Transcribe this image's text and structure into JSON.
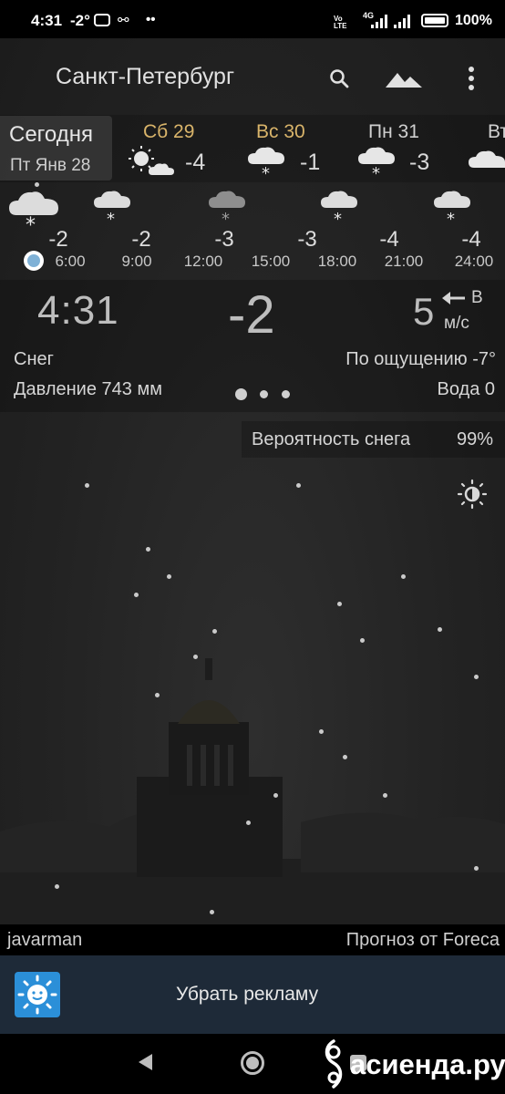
{
  "status_bar": {
    "time": "4:31",
    "temp": "-2°",
    "network": "4G",
    "volte": "Vo LTE",
    "battery": "100%"
  },
  "header": {
    "city": "Санкт-Петербург",
    "icons": [
      "search-icon",
      "landscape-icon",
      "more-vert-icon"
    ]
  },
  "days": {
    "today": {
      "label": "Сегодня",
      "date": "Пт Янв 28"
    },
    "items": [
      {
        "name": "Сб 29",
        "temp": "-4",
        "color": "#d9b46a",
        "icon": "partly-cloudy-icon"
      },
      {
        "name": "Вс 30",
        "temp": "-1",
        "color": "#d9b46a",
        "icon": "snow-cloud-icon"
      },
      {
        "name": "Пн 31",
        "temp": "-3",
        "color": "#d0d0d0",
        "icon": "snow-cloud-icon"
      },
      {
        "name": "Вт",
        "color": "#d0d0d0",
        "icon": "cloud-icon"
      }
    ]
  },
  "hourly": [
    {
      "time": "6:00",
      "temp": "-2"
    },
    {
      "time": "9:00",
      "temp": "-2"
    },
    {
      "time": "12:00",
      "temp": "-3"
    },
    {
      "time": "15:00",
      "temp": "-3"
    },
    {
      "time": "18:00",
      "temp": "-4"
    },
    {
      "time": "21:00",
      "temp": "-4"
    },
    {
      "time": "24:00",
      "temp": "-4"
    }
  ],
  "current": {
    "time": "4:31",
    "temp": "-2",
    "wind_speed": "5",
    "wind_dir": "В",
    "wind_unit": "м/с",
    "condition": "Снег",
    "feels_like": "По ощущению -7°",
    "pressure": "Давление 743 мм",
    "water": "Вода 0"
  },
  "probability": {
    "label": "Вероятность снега",
    "value": "99%"
  },
  "footer": {
    "user": "javarman",
    "source": "Прогноз от Foreca",
    "ad_label": "Убрать рекламу"
  },
  "watermark": "асиенда.ру",
  "colors": {
    "accent_day": "#d9b46a",
    "now_dot": "#7fb1d6",
    "ad_icon": "#2b8fd8"
  }
}
